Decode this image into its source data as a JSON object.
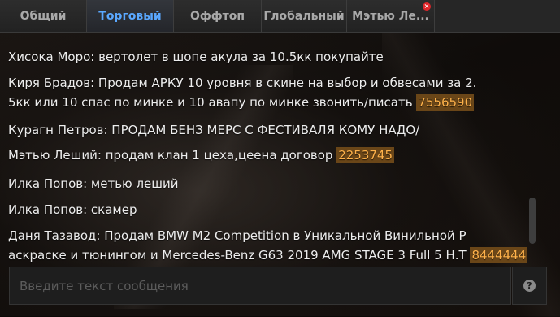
{
  "tabs": [
    {
      "label": "Общий",
      "active": false
    },
    {
      "label": "Торговый",
      "active": true
    },
    {
      "label": "Оффтоп",
      "active": false
    },
    {
      "label": "Глобальный",
      "active": false
    },
    {
      "label": "Мэтью Ле...",
      "active": false,
      "close_icon": "×"
    }
  ],
  "messages": [
    {
      "line1": "Хисока Моро: вертолет в шопе акула за 10.5кк покупайте"
    },
    {
      "line1": "Киря Брадов: Продам АРКУ 10 уровня в скине на выбор и обвесами за 2.",
      "line2": "5кк или 10 спас по минке и 10 авапу по минке  звонить/писать ",
      "phone": "7556590"
    },
    {
      "line1": "Курагн Петров: ПРОДАМ БЕНЗ МЕРС С ФЕСТИВАЛЯ КОМУ НАДО/"
    },
    {
      "line1": "Мэтью Леший: продам клан 1 цеха,цеена договор ",
      "phone": "2253745"
    },
    {
      "line1": "Илка Попов: метью леший"
    },
    {
      "line1": "Илка Попов: скамер"
    },
    {
      "line1": "Даня Тазавод: Продам BMW M2 Competition в Уникальной Винильной Р",
      "line2": "аскраске и тюнингом и Mercedes-Benz G63 2019 AMG STAGE 3 Full 5 Н.Т ",
      "phone": "8444444"
    }
  ],
  "input": {
    "placeholder": "Введите текст сообщения",
    "value": ""
  },
  "help_icon": "?",
  "colors": {
    "active_tab": "#5aa8ff",
    "phone_bg": "#6a4618",
    "phone_text": "#ffb24a",
    "close_badge": "#e0262a"
  }
}
